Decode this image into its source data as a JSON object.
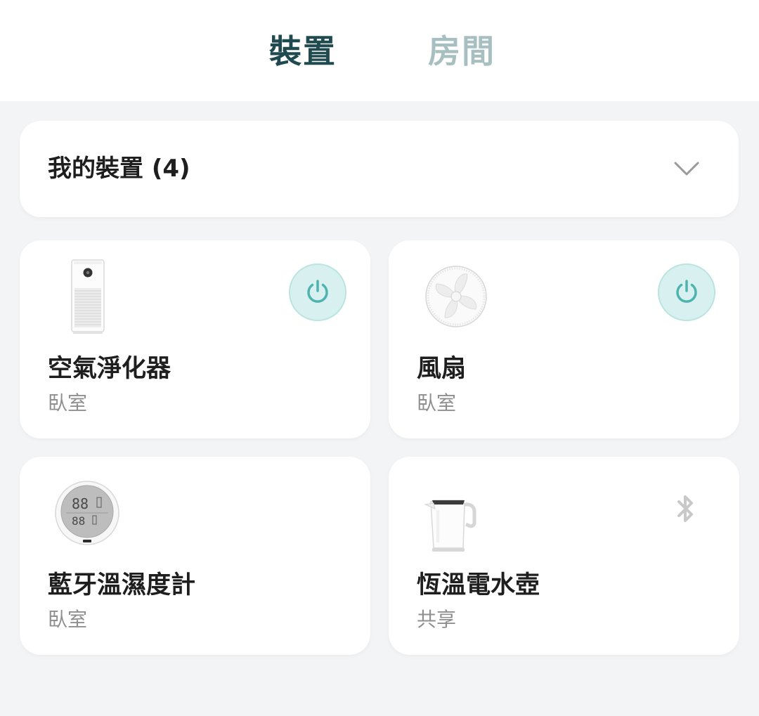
{
  "tabs": {
    "devices": "裝置",
    "rooms": "房間"
  },
  "section": {
    "title": "我的裝置 (4)",
    "chevron_icon": "chevron-down-icon"
  },
  "devices": [
    {
      "name": "空氣淨化器",
      "room": "臥室",
      "image": "air-purifier-image",
      "control_icon": "power-icon"
    },
    {
      "name": "風扇",
      "room": "臥室",
      "image": "fan-image",
      "control_icon": "power-icon"
    },
    {
      "name": "藍牙溫濕度計",
      "room": "臥室",
      "image": "thermometer-hygrometer-image"
    },
    {
      "name": "恆溫電水壺",
      "room": "共享",
      "image": "kettle-image",
      "status_icon": "bluetooth-icon"
    }
  ],
  "colors": {
    "accent": "#4db3ae",
    "accent_bg": "#d8f1f0",
    "tab_active": "#1f4a4f",
    "tab_inactive": "#a8bfc1",
    "page_bg": "#f3f4f6",
    "secondary_text": "#8f8f8f"
  }
}
